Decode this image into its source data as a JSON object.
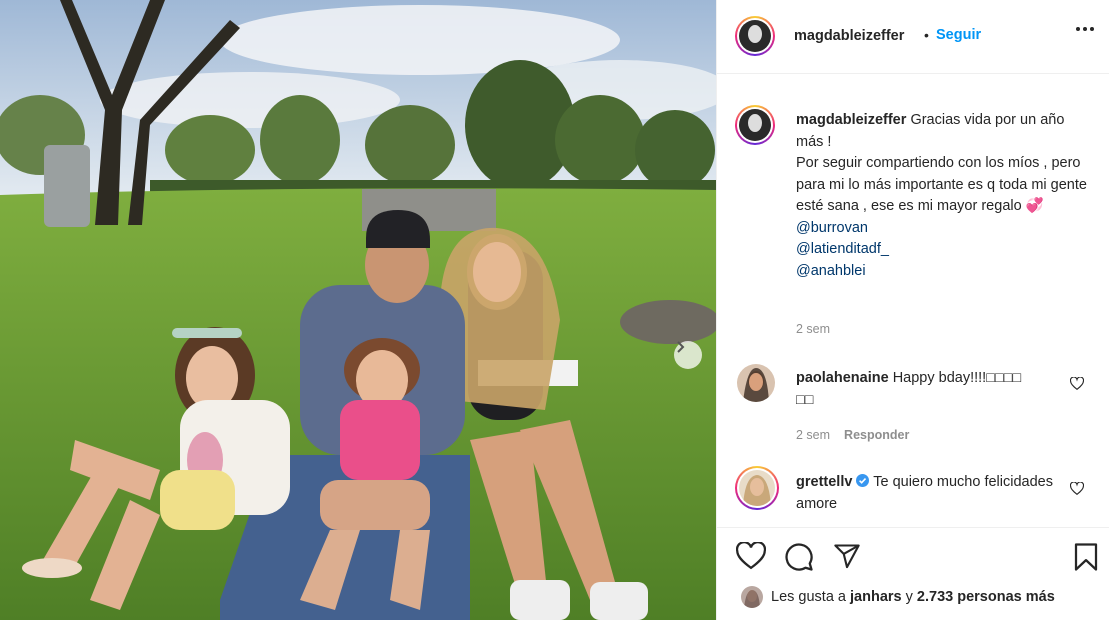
{
  "post": {
    "author": "magdableizeffer",
    "follow_label": "Seguir",
    "follow_dot": "•"
  },
  "caption": {
    "username": "magdableizeffer",
    "line1": "Gracias vida por un año más !",
    "line2": "Por seguir compartiendo con los míos , pero para mi lo más importante es q toda mi gente esté sana , ese es mi mayor regalo",
    "emoji": "💞",
    "mentions": [
      "@burrovan",
      "@latienditadf_",
      "@anahblei"
    ],
    "time": "2 sem"
  },
  "comments": [
    {
      "username": "paolahenaine",
      "text": "Happy bday!!!!",
      "emojis_line1": "□□□□",
      "emojis_line2": "□□",
      "time": "2 sem",
      "reply_label": "Responder"
    },
    {
      "username": "grettellv",
      "verified": true,
      "text": "Te quiero mucho felicidades amore"
    }
  ],
  "likes": {
    "prefix": "Les gusta a",
    "user": "janhars",
    "conjunction": "y",
    "count_text": "2.733 personas más"
  },
  "icons": {
    "more": "more-options-icon",
    "like": "heart-icon",
    "comment": "comment-icon",
    "share": "paper-plane-icon",
    "save": "bookmark-icon",
    "next": "chevron-right-icon",
    "verified": "verified-badge-icon"
  },
  "colors": {
    "link": "#0095f6",
    "mention": "#00376b",
    "muted": "#8e8e8e",
    "verified": "#3897f0"
  }
}
